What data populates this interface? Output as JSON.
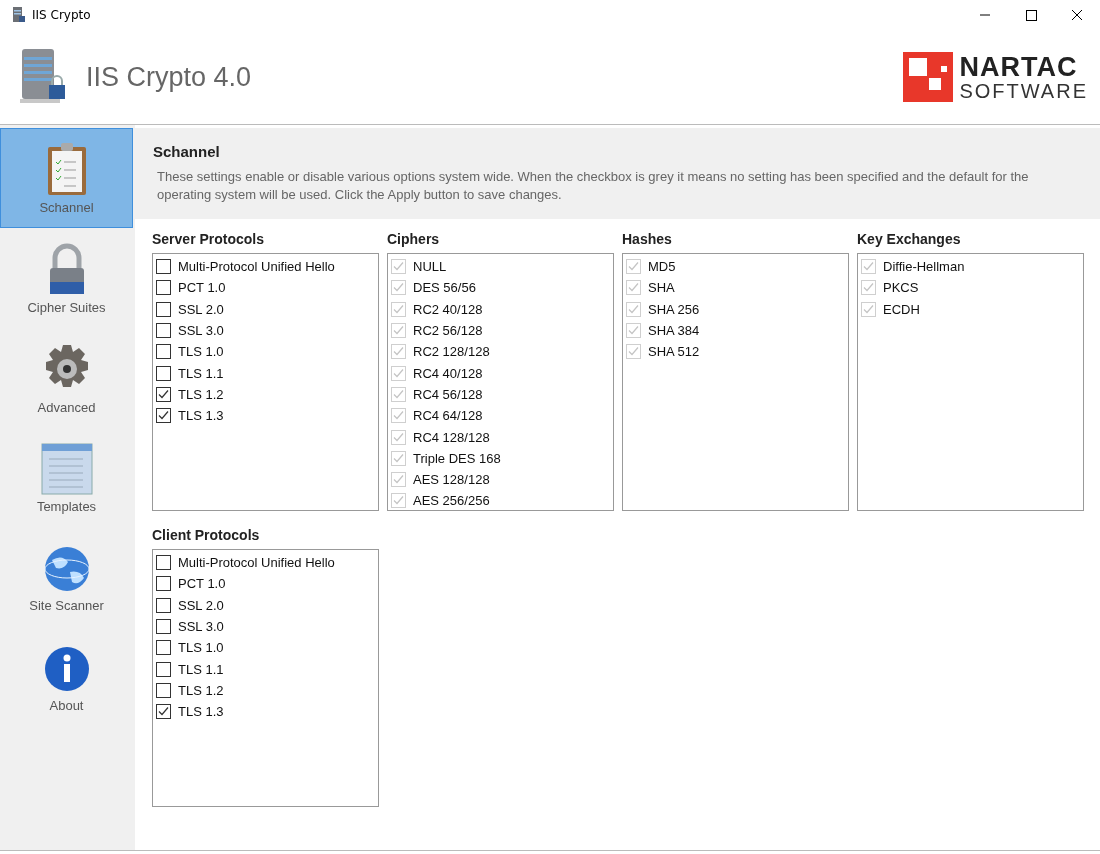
{
  "window": {
    "title": "IIS Crypto"
  },
  "header": {
    "title": "IIS Crypto 4.0",
    "logo_top": "NARTAC",
    "logo_bottom": "SOFTWARE"
  },
  "sidebar": {
    "items": [
      {
        "label": "Schannel",
        "kind": "clipboard",
        "selected": true
      },
      {
        "label": "Cipher Suites",
        "kind": "padlock",
        "selected": false
      },
      {
        "label": "Advanced",
        "kind": "gear",
        "selected": false
      },
      {
        "label": "Templates",
        "kind": "list",
        "selected": false
      },
      {
        "label": "Site Scanner",
        "kind": "globe",
        "selected": false
      },
      {
        "label": "About",
        "kind": "info",
        "selected": false
      }
    ]
  },
  "section": {
    "title": "Schannel",
    "description": "These settings enable or disable various options system wide. When the checkbox is grey it means no setting has been specified and the default for the operating system will be used. Click the Apply button to save changes."
  },
  "groups": [
    {
      "title": "Server Protocols",
      "items": [
        {
          "label": "Multi-Protocol Unified Hello",
          "checked": false,
          "greyed": false
        },
        {
          "label": "PCT 1.0",
          "checked": false,
          "greyed": false
        },
        {
          "label": "SSL 2.0",
          "checked": false,
          "greyed": false
        },
        {
          "label": "SSL 3.0",
          "checked": false,
          "greyed": false
        },
        {
          "label": "TLS 1.0",
          "checked": false,
          "greyed": false
        },
        {
          "label": "TLS 1.1",
          "checked": false,
          "greyed": false
        },
        {
          "label": "TLS 1.2",
          "checked": true,
          "greyed": false
        },
        {
          "label": "TLS 1.3",
          "checked": true,
          "greyed": false
        }
      ]
    },
    {
      "title": "Ciphers",
      "items": [
        {
          "label": "NULL",
          "checked": true,
          "greyed": true
        },
        {
          "label": "DES 56/56",
          "checked": true,
          "greyed": true
        },
        {
          "label": "RC2 40/128",
          "checked": true,
          "greyed": true
        },
        {
          "label": "RC2 56/128",
          "checked": true,
          "greyed": true
        },
        {
          "label": "RC2 128/128",
          "checked": true,
          "greyed": true
        },
        {
          "label": "RC4 40/128",
          "checked": true,
          "greyed": true
        },
        {
          "label": "RC4 56/128",
          "checked": true,
          "greyed": true
        },
        {
          "label": "RC4 64/128",
          "checked": true,
          "greyed": true
        },
        {
          "label": "RC4 128/128",
          "checked": true,
          "greyed": true
        },
        {
          "label": "Triple DES 168",
          "checked": true,
          "greyed": true
        },
        {
          "label": "AES 128/128",
          "checked": true,
          "greyed": true
        },
        {
          "label": "AES 256/256",
          "checked": true,
          "greyed": true
        }
      ]
    },
    {
      "title": "Hashes",
      "items": [
        {
          "label": "MD5",
          "checked": true,
          "greyed": true
        },
        {
          "label": "SHA",
          "checked": true,
          "greyed": true
        },
        {
          "label": "SHA 256",
          "checked": true,
          "greyed": true
        },
        {
          "label": "SHA 384",
          "checked": true,
          "greyed": true
        },
        {
          "label": "SHA 512",
          "checked": true,
          "greyed": true
        }
      ]
    },
    {
      "title": "Key Exchanges",
      "items": [
        {
          "label": "Diffie-Hellman",
          "checked": true,
          "greyed": true
        },
        {
          "label": "PKCS",
          "checked": true,
          "greyed": true
        },
        {
          "label": "ECDH",
          "checked": true,
          "greyed": true
        }
      ]
    },
    {
      "title": "Client Protocols",
      "items": [
        {
          "label": "Multi-Protocol Unified Hello",
          "checked": false,
          "greyed": false
        },
        {
          "label": "PCT 1.0",
          "checked": false,
          "greyed": false
        },
        {
          "label": "SSL 2.0",
          "checked": false,
          "greyed": false
        },
        {
          "label": "SSL 3.0",
          "checked": false,
          "greyed": false
        },
        {
          "label": "TLS 1.0",
          "checked": false,
          "greyed": false
        },
        {
          "label": "TLS 1.1",
          "checked": false,
          "greyed": false
        },
        {
          "label": "TLS 1.2",
          "checked": false,
          "greyed": false
        },
        {
          "label": "TLS 1.3",
          "checked": true,
          "greyed": false
        }
      ]
    }
  ]
}
